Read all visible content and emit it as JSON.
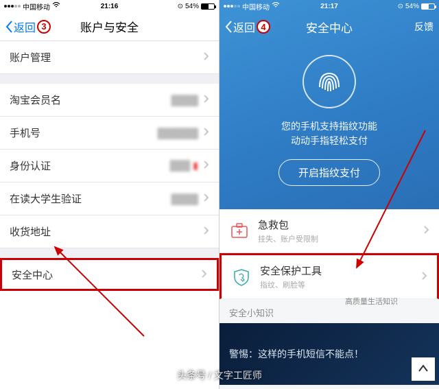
{
  "left": {
    "status": {
      "carrier": "中国移动",
      "time": "21:16",
      "battery": "54%"
    },
    "nav": {
      "back": "返回",
      "title": "账户与安全",
      "step": "3"
    },
    "rows": {
      "account_mgmt": "账户管理",
      "member_name": "淘宝会员名",
      "phone": "手机号",
      "identity": "身份认证",
      "student": "在读大学生验证",
      "address": "收货地址",
      "security_center": "安全中心"
    }
  },
  "right": {
    "status": {
      "carrier": "中国移动",
      "time": "21:17",
      "battery": "54%"
    },
    "nav": {
      "back": "返回",
      "title": "安全中心",
      "step": "4",
      "feedback": "反馈"
    },
    "hero": {
      "line1": "您的手机支持指纹功能",
      "line2": "动动手指轻松支付",
      "button": "开启指纹支付"
    },
    "cards": {
      "emergency": {
        "title": "急救包",
        "sub": "挂失、账户受限制"
      },
      "tools": {
        "title": "安全保护工具",
        "sub": "指纹、刷脸等"
      }
    },
    "tips_header": "安全小知识",
    "tips_note": "高质量生活知识",
    "banner": "警惕：这样的手机短信不能点！"
  },
  "watermark": "头条号 / 文字工匠师"
}
